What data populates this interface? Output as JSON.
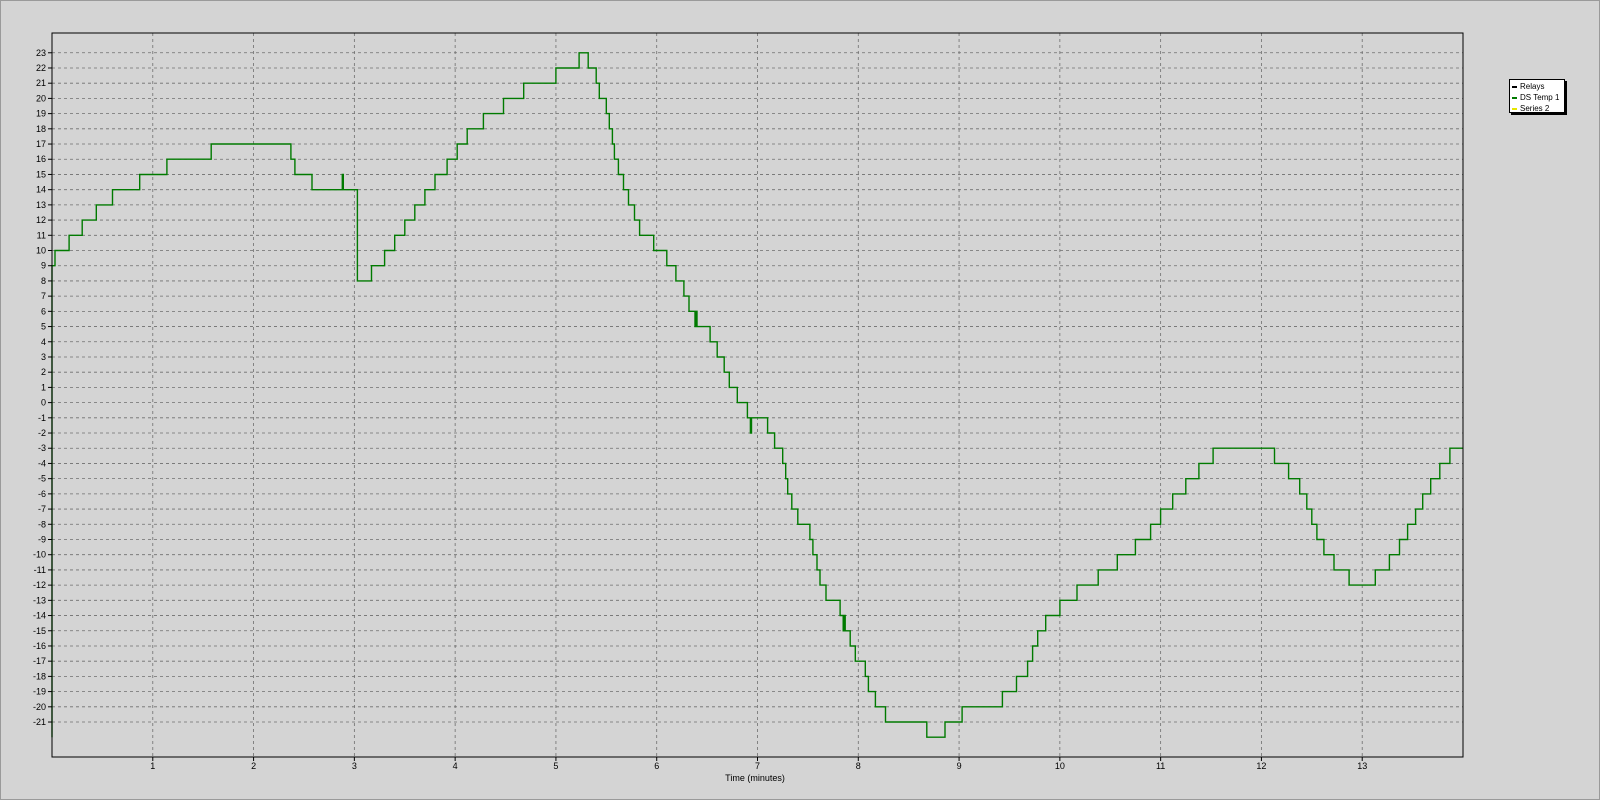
{
  "chart_data": {
    "type": "line",
    "title": "",
    "xlabel": "Time (minutes)",
    "ylabel": "",
    "xlim": [
      0,
      14
    ],
    "ylim": [
      -23.3,
      24.3
    ],
    "x_ticks": [
      1,
      2,
      3,
      4,
      5,
      6,
      7,
      8,
      9,
      10,
      11,
      12,
      13
    ],
    "y_ticks": [
      23,
      22,
      21,
      20,
      19,
      18,
      17,
      16,
      15,
      14,
      13,
      12,
      11,
      10,
      9,
      8,
      7,
      6,
      5,
      4,
      3,
      2,
      1,
      0,
      -1,
      -2,
      -3,
      -4,
      -5,
      -6,
      -7,
      -8,
      -9,
      -10,
      -11,
      -12,
      -13,
      -14,
      -15,
      -16,
      -17,
      -18,
      -19,
      -20,
      -21
    ],
    "grid": true,
    "legend_position": "right",
    "legend": [
      {
        "name": "Relays",
        "color": "#000000"
      },
      {
        "name": "DS Temp 1",
        "color": "#007a00"
      },
      {
        "name": "Series 2",
        "color": "#e6e600"
      }
    ],
    "series": [
      {
        "name": "DS Temp 1",
        "color": "#007a00",
        "step": true,
        "points": [
          [
            0.0,
            -22
          ],
          [
            0.0,
            9
          ],
          [
            0.03,
            10
          ],
          [
            0.17,
            11
          ],
          [
            0.3,
            12
          ],
          [
            0.44,
            13
          ],
          [
            0.6,
            14
          ],
          [
            0.87,
            15
          ],
          [
            1.14,
            16
          ],
          [
            1.58,
            17
          ],
          [
            2.37,
            16
          ],
          [
            2.41,
            15
          ],
          [
            2.58,
            14
          ],
          [
            2.88,
            15
          ],
          [
            2.89,
            14
          ],
          [
            3.03,
            8
          ],
          [
            3.17,
            9
          ],
          [
            3.3,
            10
          ],
          [
            3.4,
            11
          ],
          [
            3.5,
            12
          ],
          [
            3.6,
            13
          ],
          [
            3.7,
            14
          ],
          [
            3.8,
            15
          ],
          [
            3.92,
            16
          ],
          [
            4.02,
            17
          ],
          [
            4.12,
            18
          ],
          [
            4.28,
            19
          ],
          [
            4.48,
            20
          ],
          [
            4.68,
            21
          ],
          [
            5.0,
            22
          ],
          [
            5.23,
            23
          ],
          [
            5.32,
            22
          ],
          [
            5.4,
            21
          ],
          [
            5.43,
            20
          ],
          [
            5.5,
            19
          ],
          [
            5.53,
            18
          ],
          [
            5.56,
            17
          ],
          [
            5.58,
            16
          ],
          [
            5.62,
            15
          ],
          [
            5.67,
            14
          ],
          [
            5.72,
            13
          ],
          [
            5.78,
            12
          ],
          [
            5.83,
            11
          ],
          [
            5.97,
            10
          ],
          [
            6.1,
            9
          ],
          [
            6.19,
            8
          ],
          [
            6.27,
            7
          ],
          [
            6.32,
            6
          ],
          [
            6.38,
            5
          ],
          [
            6.39,
            6
          ],
          [
            6.4,
            5
          ],
          [
            6.53,
            4
          ],
          [
            6.6,
            3
          ],
          [
            6.67,
            2
          ],
          [
            6.72,
            1
          ],
          [
            6.8,
            0
          ],
          [
            6.9,
            -1
          ],
          [
            6.93,
            -2
          ],
          [
            6.94,
            -1
          ],
          [
            7.1,
            -2
          ],
          [
            7.17,
            -3
          ],
          [
            7.25,
            -4
          ],
          [
            7.28,
            -5
          ],
          [
            7.3,
            -6
          ],
          [
            7.34,
            -7
          ],
          [
            7.4,
            -8
          ],
          [
            7.52,
            -9
          ],
          [
            7.55,
            -10
          ],
          [
            7.59,
            -11
          ],
          [
            7.62,
            -12
          ],
          [
            7.68,
            -13
          ],
          [
            7.82,
            -14
          ],
          [
            7.85,
            -15
          ],
          [
            7.86,
            -14
          ],
          [
            7.87,
            -15
          ],
          [
            7.92,
            -16
          ],
          [
            7.97,
            -17
          ],
          [
            8.07,
            -18
          ],
          [
            8.1,
            -19
          ],
          [
            8.17,
            -20
          ],
          [
            8.27,
            -21
          ],
          [
            8.68,
            -22
          ],
          [
            8.86,
            -21
          ],
          [
            9.03,
            -20
          ],
          [
            9.43,
            -19
          ],
          [
            9.57,
            -18
          ],
          [
            9.68,
            -17
          ],
          [
            9.73,
            -16
          ],
          [
            9.78,
            -15
          ],
          [
            9.86,
            -14
          ],
          [
            10.0,
            -13
          ],
          [
            10.17,
            -12
          ],
          [
            10.38,
            -11
          ],
          [
            10.57,
            -10
          ],
          [
            10.75,
            -9
          ],
          [
            10.9,
            -8
          ],
          [
            11.0,
            -7
          ],
          [
            11.12,
            -6
          ],
          [
            11.25,
            -5
          ],
          [
            11.38,
            -4
          ],
          [
            11.52,
            -3
          ],
          [
            12.13,
            -4
          ],
          [
            12.27,
            -5
          ],
          [
            12.38,
            -6
          ],
          [
            12.45,
            -7
          ],
          [
            12.5,
            -8
          ],
          [
            12.55,
            -9
          ],
          [
            12.62,
            -10
          ],
          [
            12.72,
            -11
          ],
          [
            12.87,
            -12
          ],
          [
            13.13,
            -11
          ],
          [
            13.27,
            -10
          ],
          [
            13.37,
            -9
          ],
          [
            13.45,
            -8
          ],
          [
            13.53,
            -7
          ],
          [
            13.6,
            -6
          ],
          [
            13.68,
            -5
          ],
          [
            13.77,
            -4
          ],
          [
            13.87,
            -3
          ],
          [
            14.0,
            -3
          ]
        ]
      }
    ]
  }
}
